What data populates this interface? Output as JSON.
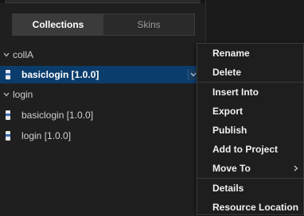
{
  "tabs": {
    "collections": "Collections",
    "skins": "Skins"
  },
  "tree": {
    "groups": [
      {
        "name": "collA",
        "items": [
          {
            "label": "basiclogin  [1.0.0]"
          }
        ]
      },
      {
        "name": "login",
        "items": [
          {
            "label": "basiclogin  [1.0.0]"
          },
          {
            "label": "login  [1.0.0]"
          }
        ]
      }
    ]
  },
  "context_menu": {
    "items": {
      "rename": "Rename",
      "delete": "Delete",
      "insert_into": "Insert Into",
      "export": "Export",
      "publish": "Publish",
      "add_to_project": "Add to Project",
      "move_to": "Move To",
      "details": "Details",
      "resource_location": "Resource Location"
    }
  },
  "colors": {
    "selection": "#0b3d6c",
    "background": "#1f1f1f",
    "menu_background": "#1e1e1e"
  }
}
